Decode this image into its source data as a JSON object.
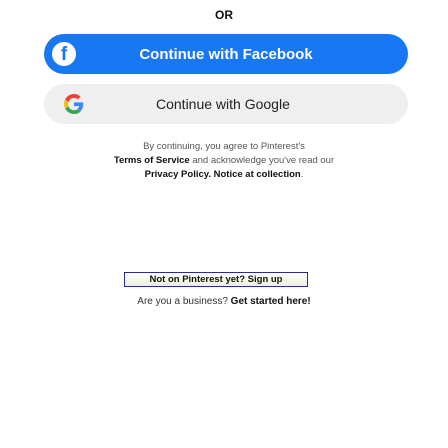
{
  "divider": {
    "or_label": "OR"
  },
  "facebook": {
    "label": "Continue with Facebook",
    "icon": "facebook-icon",
    "color": "#1877f2"
  },
  "google": {
    "label": "Continue with Google",
    "icon": "google-icon",
    "color": "#efefef"
  },
  "legal": {
    "line1": "By continuing, you agree to Pinterest's",
    "terms_link": "Terms of Service",
    "line2_mid": " and acknowledge you've read our",
    "privacy_link": "Privacy Policy",
    "sep": ". ",
    "notice_link": "Notice at collection",
    "end": "."
  },
  "signup": {
    "label": "Not on Pinterest yet? Sign up"
  },
  "business": {
    "prefix": "Are you a business? ",
    "link": "Get started here!"
  }
}
